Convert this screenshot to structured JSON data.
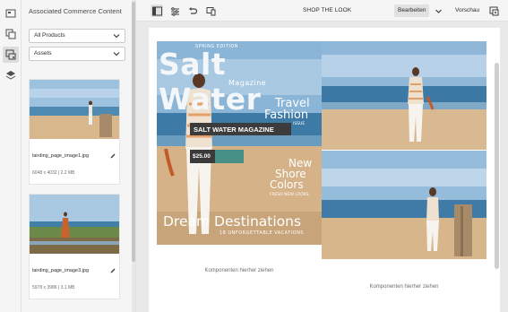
{
  "rail": {
    "icons": [
      "pages-icon",
      "components-icon",
      "assets-icon",
      "layers-icon"
    ]
  },
  "panel": {
    "title": "Associated Commerce Content",
    "products_filter": "All Products",
    "type_filter": "Assets",
    "assets": [
      {
        "filename": "landing_page_image1.jpg",
        "meta": "6048 x 4032 | 2.2 MB"
      },
      {
        "filename": "landing_page_image3.jpg",
        "meta": "5978 x 3986 | 3.1 MB"
      }
    ]
  },
  "topbar": {
    "page_title": "SHOP THE LOOK",
    "edit_label": "Bearbeiten",
    "preview_label": "Vorschau"
  },
  "magazine": {
    "edition": "SPRING EDITION",
    "title": "Salt Water",
    "subtitle": "Magazine",
    "travel": "Travel",
    "fashion": "Fashion",
    "issue": "ISSUE",
    "banner": "SALT WATER MAGAZINE",
    "price": "$25.00",
    "new": "New",
    "shore": "Shore",
    "colors": "Colors",
    "fresh": "FRESH NEW LOOKS",
    "dream": "Dream Destinations",
    "vacations": "18 UNFORGETTABLE VACATIONS"
  },
  "canvas": {
    "placeholder_left": "Komponenten hierher ziehen",
    "placeholder_right": "Komponenten hierher ziehen"
  },
  "colors": {
    "sky": "#8fb8d8",
    "sea": "#4a86b0",
    "sand": "#d9b890",
    "teal_price": "#2d8a87"
  }
}
